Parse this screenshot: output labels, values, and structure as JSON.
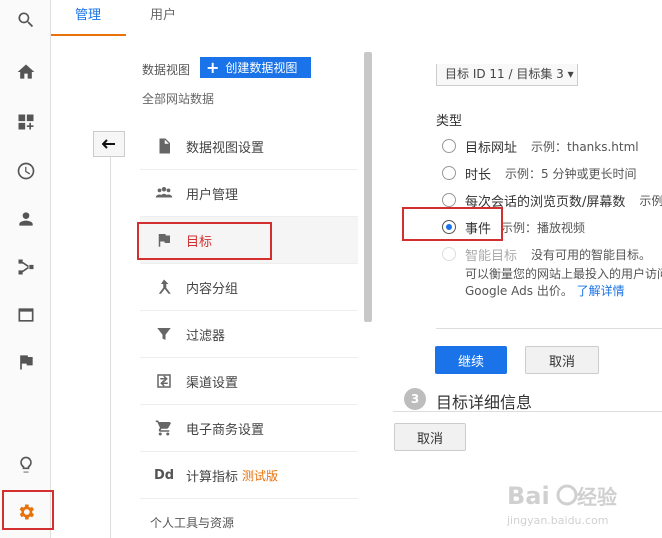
{
  "tabs": {
    "admin": "管理",
    "users": "用户"
  },
  "menu": {
    "view_label": "数据视图",
    "create_view": "创建数据视图",
    "all_site_data": "全部网站数据",
    "items": [
      {
        "label": "数据视图设置",
        "icon": "document-icon"
      },
      {
        "label": "用户管理",
        "icon": "people-icon"
      },
      {
        "label": "目标",
        "icon": "flag-icon"
      },
      {
        "label": "内容分组",
        "icon": "grouping-icon"
      },
      {
        "label": "过滤器",
        "icon": "filter-icon"
      },
      {
        "label": "渠道设置",
        "icon": "channel-icon"
      },
      {
        "label": "电子商务设置",
        "icon": "cart-icon"
      },
      {
        "label": "计算指标",
        "icon": "dd-icon",
        "badge": "测试版"
      }
    ],
    "personal_tools": "个人工具与资源"
  },
  "goal": {
    "id_select": "目标 ID 11 / 目标集 3",
    "type_heading": "类型",
    "types": [
      {
        "label": "目标网址",
        "example": "示例：thanks.html"
      },
      {
        "label": "时长",
        "example": "示例：5 分钟或更长时间"
      },
      {
        "label": "每次会话的浏览页数/屏幕数",
        "example": "示例"
      },
      {
        "label": "事件",
        "example": "示例：播放视频"
      },
      {
        "label": "智能目标",
        "example": "没有可用的智能目标。"
      }
    ],
    "smart_desc_line1": "可以衡量您的网站上最投入的用户访问",
    "smart_desc_line2": "Google Ads 出价。",
    "learn_more": "了解详情",
    "continue": "继续",
    "cancel": "取消",
    "step_number": "3",
    "step_title": "目标详细信息",
    "cancel_bottom": "取消"
  },
  "colors": {
    "accent": "#1a73e8",
    "highlight": "#d32f2f",
    "orange": "#e8710a"
  }
}
